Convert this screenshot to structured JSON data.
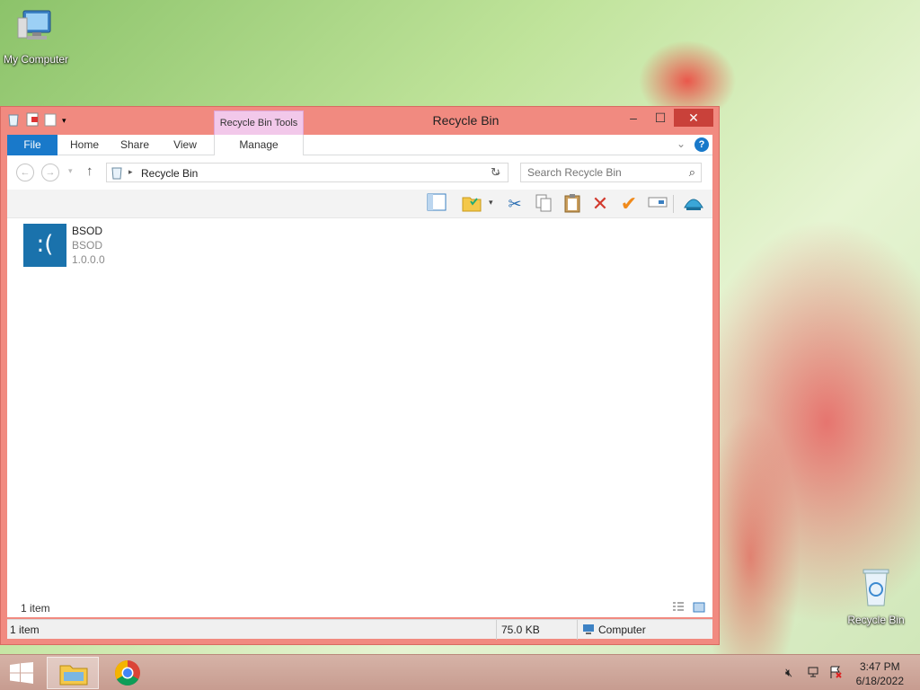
{
  "desktop": {
    "icons": [
      {
        "label": "My Computer",
        "icon": "computer-icon"
      },
      {
        "label": "Recycle Bin",
        "icon": "recycle-bin-icon"
      }
    ]
  },
  "window": {
    "title": "Recycle Bin",
    "context_tab_group": "Recycle Bin Tools",
    "ribbon_tabs": [
      "File",
      "Home",
      "Share",
      "View",
      "Manage"
    ],
    "address": {
      "location": "Recycle Bin"
    },
    "search": {
      "placeholder": "Search Recycle Bin"
    },
    "items": [
      {
        "name": "BSOD",
        "publisher": "BSOD",
        "version": "1.0.0.0",
        "tile_text": ":("
      }
    ],
    "status_count": "1 item",
    "details_bar": {
      "count": "1 item",
      "size": "75.0 KB",
      "location": "Computer"
    }
  },
  "taskbar": {
    "time": "3:47 PM",
    "date": "6/18/2022"
  },
  "colors": {
    "window_frame": "#f18a80",
    "file_tab": "#1979ca",
    "close_button": "#c9413a",
    "tile_blue": "#1a72ac"
  }
}
